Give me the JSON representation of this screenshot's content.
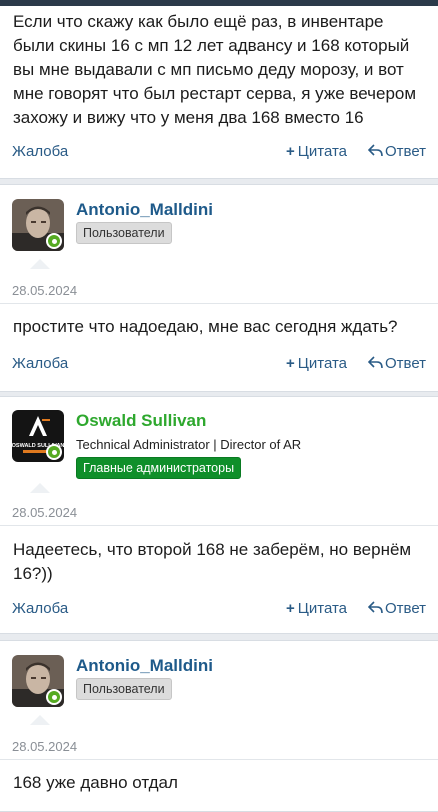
{
  "actions": {
    "report": "Жалоба",
    "quote": "Цитата",
    "reply": "Ответ"
  },
  "posts": [
    {
      "text": "Если что скажу как было ещё раз, в инвентаре были скины 16 с мп 12 лет адвансу и 168 который вы мне выдавали с мп письмо деду морозу, и вот мне говорят что был рестарт серва, я уже вечером захожу и вижу что у меня два 168 вместо 16"
    },
    {
      "author": "Antonio_Malldini",
      "author_color": "#1e5a8a",
      "banner": "Пользователи",
      "date": "28.05.2024",
      "text": "простите что надоедаю, мне вас сегодня ждать?"
    },
    {
      "author": "Oswald Sullivan",
      "author_color": "#2ea82e",
      "user_title": "Technical Administrator | Director of AR",
      "banner": "Главные администраторы",
      "avatar_text": "OSWALD SULLIVAN",
      "date": "28.05.2024",
      "text": "Надеетесь, что второй 168 не заберём, но вернём 16?))"
    },
    {
      "author": "Antonio_Malldini",
      "author_color": "#1e5a8a",
      "banner": "Пользователи",
      "date": "28.05.2024",
      "text": "168 уже давно отдал"
    }
  ]
}
